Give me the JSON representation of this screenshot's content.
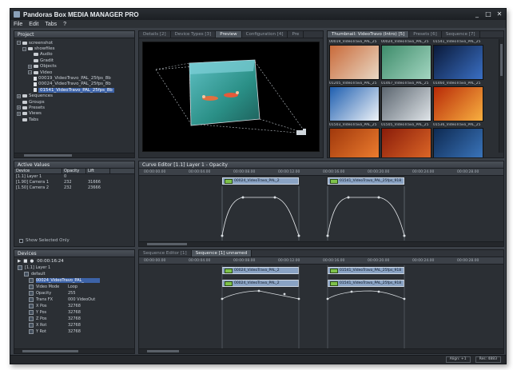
{
  "window": {
    "title": "Pandoras Box MEDIA MANAGER PRO"
  },
  "menu": [
    "File",
    "Edit",
    "Tabs",
    "?"
  ],
  "project": {
    "header": "Project",
    "tree": [
      {
        "label": "screenshot",
        "level": 0,
        "kind": "folder",
        "tog": "−",
        "selected": false
      },
      {
        "label": "showfiles",
        "level": 1,
        "kind": "folder",
        "tog": "−",
        "selected": false
      },
      {
        "label": "Audio",
        "level": 2,
        "kind": "folder",
        "tog": "",
        "selected": false
      },
      {
        "label": "Gradit",
        "level": 2,
        "kind": "folder",
        "tog": "",
        "selected": false
      },
      {
        "label": "Objects",
        "level": 2,
        "kind": "folder",
        "tog": "+",
        "selected": false
      },
      {
        "label": "Video",
        "level": 2,
        "kind": "folder",
        "tog": "−",
        "selected": false
      },
      {
        "label": "00019_VideoTravo_PAL_25fps_8b",
        "level": 3,
        "kind": "file",
        "tog": "",
        "selected": false
      },
      {
        "label": "00024_VideoTravo_PAL_25fps_8b",
        "level": 3,
        "kind": "file",
        "tog": "",
        "selected": false
      },
      {
        "label": "01541_VideoTravo_PAL_25fps_8b",
        "level": 3,
        "kind": "file",
        "tog": "",
        "selected": true
      },
      {
        "label": "Sequences",
        "level": 0,
        "kind": "folder",
        "tog": "+",
        "selected": false
      },
      {
        "label": "Groups",
        "level": 0,
        "kind": "folder",
        "tog": "",
        "selected": false
      },
      {
        "label": "Presets",
        "level": 0,
        "kind": "folder",
        "tog": "+",
        "selected": false
      },
      {
        "label": "Views",
        "level": 0,
        "kind": "folder",
        "tog": "+",
        "selected": false
      },
      {
        "label": "Tabs",
        "level": 0,
        "kind": "folder",
        "tog": "",
        "selected": false
      }
    ]
  },
  "preview": {
    "tabs": [
      "Details [2]",
      "Device Types [3]",
      "Preview",
      "Configuration [4]",
      "Pre"
    ],
    "active_tab": "Preview"
  },
  "thumbnails": {
    "tabs": [
      "Thumbnail: VideoTravo (Intro) [5]",
      "Presets [6]",
      "Sequence [7]"
    ],
    "items": [
      {
        "caption": "00019_VideoTravo_PAL_25",
        "color_a": "#c96a3a",
        "color_b": "#e9d8c4"
      },
      {
        "caption": "00024_VideoTravo_PAL_25",
        "color_a": "#3e8c6b",
        "color_b": "#a4d6c1"
      },
      {
        "caption": "01541_VideoTravo_PAL_25",
        "color_a": "#0a1a3a",
        "color_b": "#3a6fc4"
      },
      {
        "caption": "01205_VideoTravo_PAL_25",
        "color_a": "#1f5fb0",
        "color_b": "#eef3f8"
      },
      {
        "caption": "01467_VideoTravo_PAL_25",
        "color_a": "#5c6670",
        "color_b": "#dfe4e8"
      },
      {
        "caption": "01460_VideoTravo_PAL_25",
        "color_a": "#b82a08",
        "color_b": "#f8b040"
      },
      {
        "caption": "01503_VideoTravo_PAL_25",
        "color_a": "#a0380c",
        "color_b": "#f08030"
      },
      {
        "caption": "01505_VideoTravo_PAL_25",
        "color_a": "#8a1c0a",
        "color_b": "#e06a28"
      },
      {
        "caption": "01536_VideoTravo_PAL_25",
        "color_a": "#0e2a52",
        "color_b": "#3c78c0"
      }
    ]
  },
  "active_values": {
    "header": "Active Values",
    "columns": [
      "Device",
      "Opacity",
      "Lift"
    ],
    "rows": [
      [
        "[1.1] Layer 1",
        "0",
        ""
      ],
      [
        "[1.90] Camera 1",
        "232",
        "31666"
      ],
      [
        "[1.50] Camera 2",
        "232",
        "23666"
      ]
    ],
    "show_selected": "Show Selected Only"
  },
  "curve_editor": {
    "header": "Curve Editor [1.1] Layer 1 - Opacity",
    "ruler": [
      "00:00:00.00",
      "00:00:04.00",
      "00:00:08.00",
      "00:00:12.00",
      "00:00:16.00",
      "00:00:20.00",
      "00:00:24.00",
      "00:00:28.00"
    ],
    "clip1": "00024_VideoTravo_PAL_2",
    "clip2": "01541_VideoTravo_PAL_25fps_918"
  },
  "devices": {
    "header": "Devices",
    "timecode": "00:00:16:24",
    "tree": [
      {
        "label": "[1.1] Layer 1",
        "value": ""
      },
      {
        "label": "default",
        "value": ""
      },
      {
        "label": "00024_VideoTravo_PAL_",
        "value": ""
      },
      {
        "label": "Video Mode",
        "value": "Loop"
      },
      {
        "label": "Opacity",
        "value": "255"
      },
      {
        "label": "Trans FX",
        "value": "000 VideoOut"
      },
      {
        "label": "X Pos",
        "value": "32768"
      },
      {
        "label": "Y Pos",
        "value": "32768"
      },
      {
        "label": "Z Pos",
        "value": "32768"
      },
      {
        "label": "X Rot",
        "value": "32768"
      },
      {
        "label": "Y Rot",
        "value": "32768"
      }
    ]
  },
  "sequence": {
    "tabs": [
      "Sequence Editor [1]",
      "Sequence [1] unnamed"
    ],
    "ruler": [
      "00:00:00.00",
      "00:00:04.00",
      "00:00:08.00",
      "00:00:12.00",
      "00:00:16.00",
      "00:00:20.00",
      "00:00:24.00",
      "00:00:28.00"
    ],
    "clips": [
      {
        "label": "00024_VideoTravo_PAL_2"
      },
      {
        "label": "01541_VideoTravo_PAL_25fps_918"
      },
      {
        "label": "00024_VideoTravo_PAL_2"
      },
      {
        "label": "01541_VideoTravo_PAL_25fps_918"
      }
    ]
  },
  "status": {
    "mid": "Align: +1",
    "right": "Res: 4883"
  }
}
